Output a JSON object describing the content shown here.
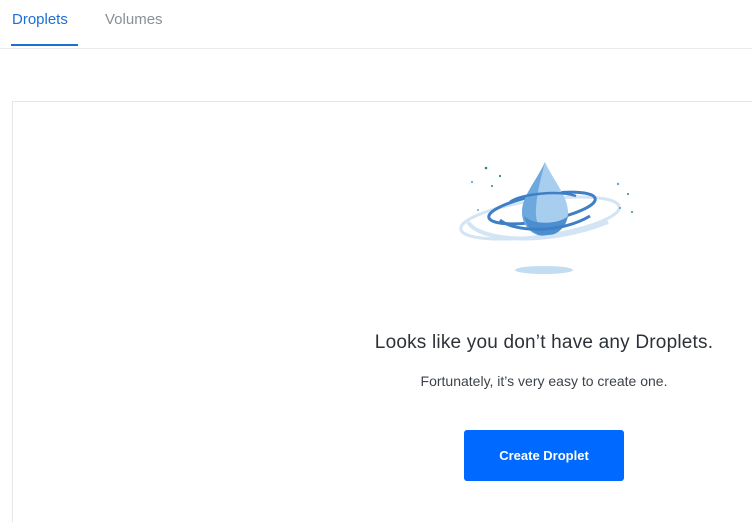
{
  "tabs": {
    "droplets_label": "Droplets",
    "volumes_label": "Volumes",
    "active": "Droplets"
  },
  "empty_state": {
    "illustration_icon": "water-droplet-swirl-icon",
    "title": "Looks like you don’t have any Droplets.",
    "subtitle": "Fortunately, it’s very easy to create one.",
    "button_label": "Create Droplet"
  },
  "colors": {
    "accent": "#1b70d6",
    "button": "#0069ff",
    "droplet": "#5d9fd8"
  }
}
